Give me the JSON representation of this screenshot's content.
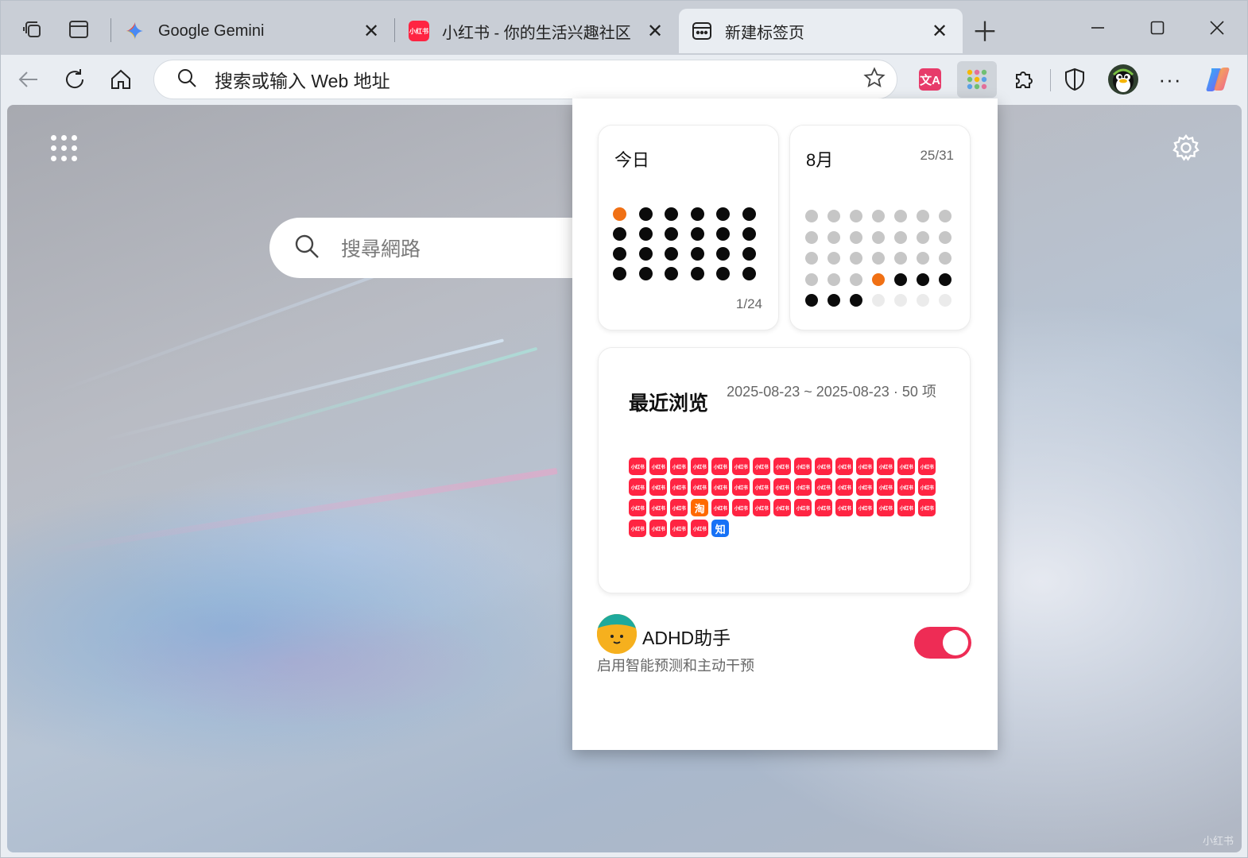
{
  "tabs": [
    {
      "title": "Google Gemini",
      "favicon": "gemini-icon",
      "active": false
    },
    {
      "title": "小红书 - 你的生活兴趣社区",
      "favicon": "xiaohongshu-icon",
      "active": false
    },
    {
      "title": "新建标签页",
      "favicon": "new-tab-icon",
      "active": true
    }
  ],
  "toolbar": {
    "address_placeholder": "搜索或输入 Web 地址"
  },
  "newtab": {
    "search_placeholder": "搜尋網路",
    "watermark": "小红书"
  },
  "popup": {
    "today": {
      "title": "今日",
      "count": "1/24",
      "total": 24,
      "current": 1,
      "accent": "#f07014"
    },
    "month": {
      "title": "8月",
      "count": "25/31",
      "total": 31,
      "current": 25,
      "accent": "#f07014"
    },
    "recent": {
      "title": "最近浏览",
      "range": "2025-08-23 ~ 2025-08-23 · 50 项",
      "items": [
        "xhs",
        "xhs",
        "xhs",
        "xhs",
        "xhs",
        "xhs",
        "xhs",
        "xhs",
        "xhs",
        "xhs",
        "xhs",
        "xhs",
        "xhs",
        "xhs",
        "xhs",
        "xhs",
        "xhs",
        "xhs",
        "xhs",
        "xhs",
        "xhs",
        "xhs",
        "xhs",
        "xhs",
        "xhs",
        "xhs",
        "xhs",
        "xhs",
        "xhs",
        "xhs",
        "xhs",
        "xhs",
        "xhs",
        "taobao",
        "xhs",
        "xhs",
        "xhs",
        "xhs",
        "xhs",
        "xhs",
        "xhs",
        "xhs",
        "xhs",
        "xhs",
        "xhs",
        "xhs",
        "xhs",
        "xhs",
        "xhs",
        "zhihu"
      ],
      "labels": {
        "xhs": "小红书",
        "taobao": "淘",
        "zhihu": "知"
      }
    },
    "adhd": {
      "name": "ADHD助手",
      "desc": "启用智能预测和主动干预",
      "enabled": true
    }
  },
  "colors": {
    "toggle_on": "#ee2c55",
    "xhs_red": "#ff2442"
  }
}
